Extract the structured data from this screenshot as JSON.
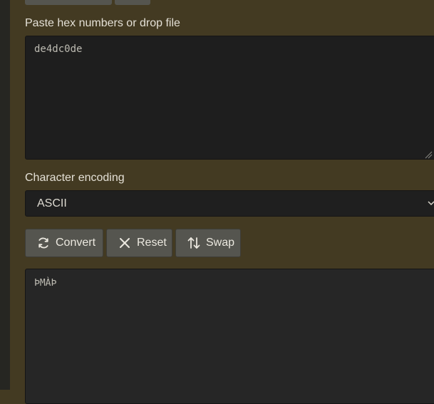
{
  "input": {
    "label": "Paste hex numbers or drop file",
    "value": "de4dc0de"
  },
  "encoding": {
    "label": "Character encoding",
    "selected": "ASCII"
  },
  "actions": {
    "convert_label": "Convert",
    "reset_label": "Reset",
    "swap_label": "Swap"
  },
  "output": {
    "value": "ÞMÀÞ"
  },
  "icons": {
    "convert": "refresh-icon",
    "reset": "close-icon",
    "swap": "swap-vertical-icon",
    "select": "chevron-down-icon"
  },
  "colors": {
    "page_background": "#433a22",
    "button_background": "#55554f",
    "field_background": "#1e1e1e"
  }
}
